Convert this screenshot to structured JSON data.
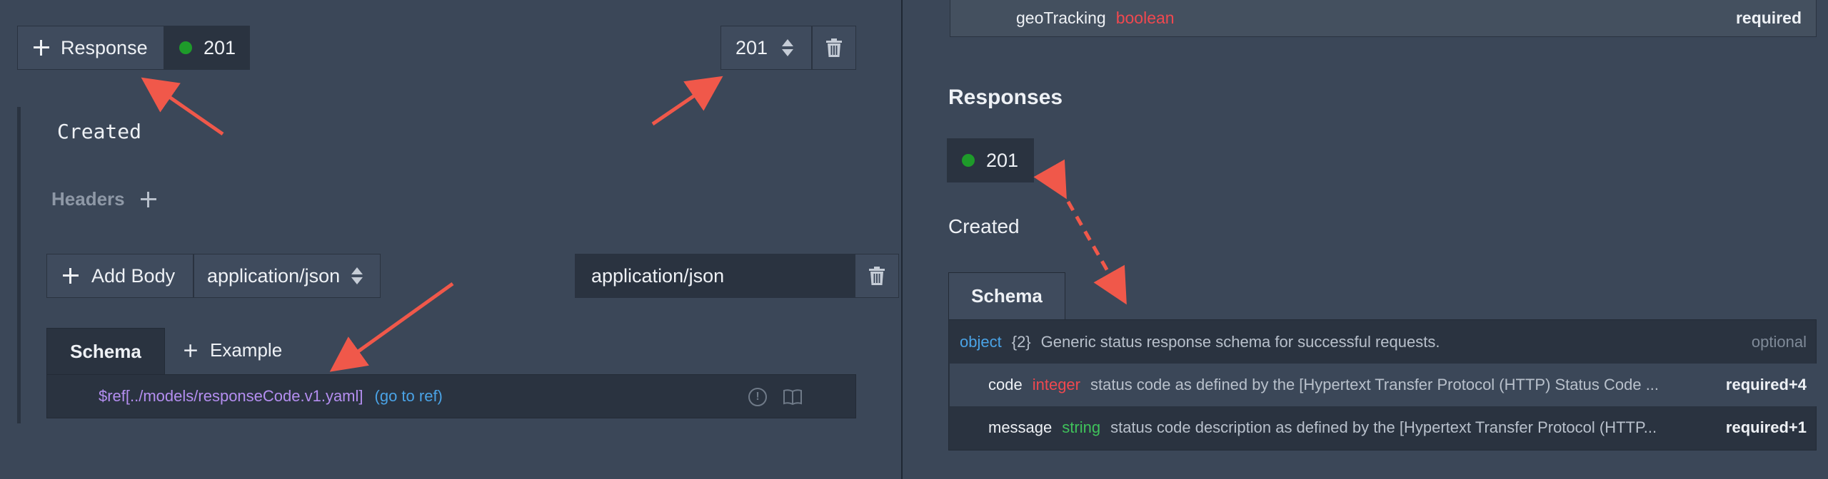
{
  "editor": {
    "add_response_label": "Response",
    "status_code": "201",
    "status_select_value": "201",
    "description": "Created",
    "headers_label": "Headers",
    "add_body_label": "Add Body",
    "content_type_select": "application/json",
    "content_type_field": "application/json",
    "tabs": {
      "schema": "Schema",
      "example": "Example"
    },
    "ref_text": "$ref[../models/responseCode.v1.yaml]",
    "go_to_ref": "(go to ref)"
  },
  "preview": {
    "top_row": {
      "name": "geoTracking",
      "type": "boolean",
      "req": "required"
    },
    "responses_heading": "Responses",
    "status_code": "201",
    "description": "Created",
    "schema_tab": "Schema",
    "object_row": {
      "type": "object",
      "count": "{2}",
      "desc": "Generic status response schema for successful requests.",
      "req": "optional"
    },
    "properties": [
      {
        "name": "code",
        "type": "integer",
        "type_color": "#f0484f",
        "desc": "status code as defined by the [Hypertext Transfer Protocol (HTTP) Status Code ...",
        "req": "required+4"
      },
      {
        "name": "message",
        "type": "string",
        "type_color": "#3fc25a",
        "desc": "status code description as defined by the [Hypertext Transfer Protocol (HTTP...",
        "req": "required+1"
      }
    ]
  },
  "colors": {
    "background": "#3b4758",
    "dark_panel": "#2a3340",
    "status_green": "#1e9b2a",
    "annotation_arrow": "#f0584a",
    "link_blue": "#4aa3e6",
    "ref_purple": "#b48ef0"
  }
}
